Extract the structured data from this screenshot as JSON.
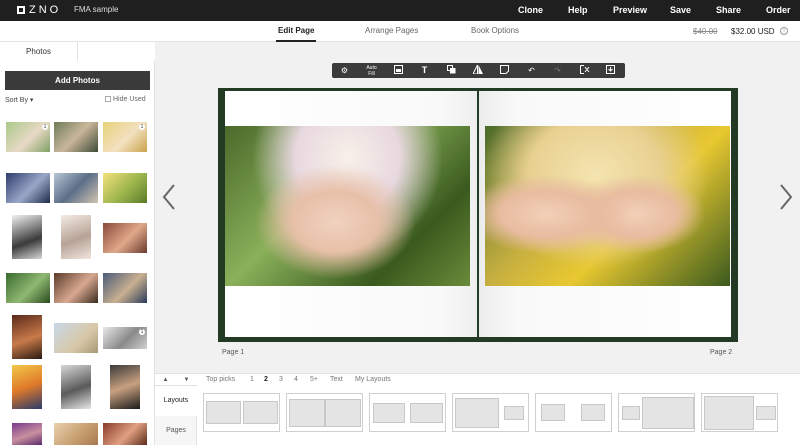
{
  "topbar": {
    "logo_text": "ZNO",
    "project_title": "FMA sample",
    "nav": [
      "Clone",
      "Help",
      "Preview",
      "Save",
      "Share",
      "Order"
    ]
  },
  "subbar": {
    "tabs": [
      "Edit Page",
      "Arrange Pages",
      "Book Options"
    ],
    "active_tab": "Edit Page",
    "price_old": "$40.00",
    "price_new": "$32.00 USD",
    "info_icon": "i"
  },
  "left_panel": {
    "tabs": [
      "Photos",
      ""
    ],
    "add_photos_label": "Add Photos",
    "sort_by_label": "Sort By ▾",
    "hide_used_label": "Hide Used",
    "badges": [
      "1",
      "1",
      "1"
    ]
  },
  "toolbar": {
    "autofill_label": "Auto\nFill",
    "text_label": "T",
    "icons": [
      "gear-icon",
      "auto-fill-icon",
      "image-icon",
      "text-icon",
      "layers-icon",
      "mirror-icon",
      "note-icon",
      "undo-icon",
      "redo-icon",
      "clear-icon",
      "export-icon"
    ]
  },
  "pages": {
    "left_label": "Page 1",
    "right_label": "Page 2"
  },
  "bottom_panel": {
    "side_tabs": [
      "Layouts",
      "Pages"
    ],
    "active_side_tab": "Layouts",
    "up_label": "▲",
    "down_label": "▼",
    "filters": [
      "Top picks",
      "1",
      "2",
      "3",
      "4",
      "5+",
      "Text",
      "My Layouts"
    ],
    "active_filter": "2"
  },
  "colors": {
    "topbar_bg": "#1f1f1f",
    "book_cover": "#233a24",
    "accent": "#222222"
  }
}
